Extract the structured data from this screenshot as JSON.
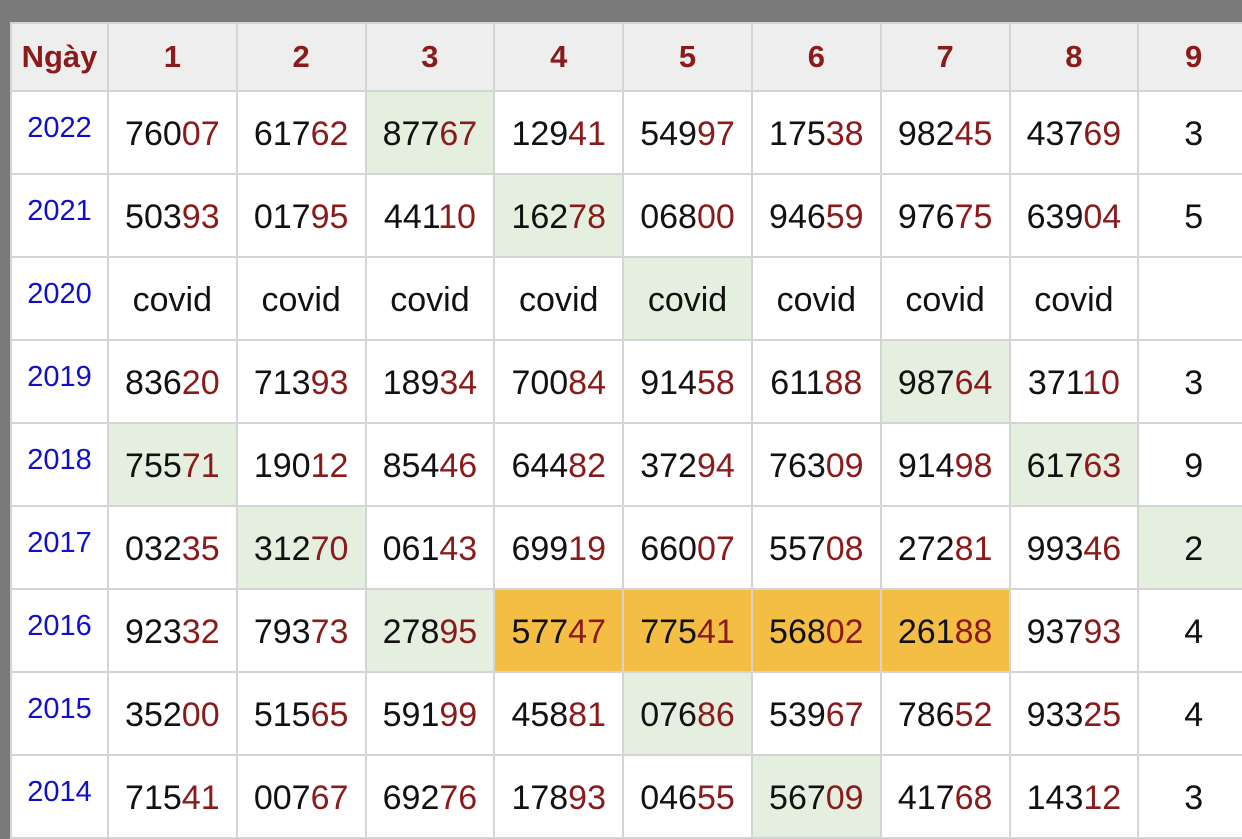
{
  "header": {
    "year_label": "Ngày",
    "days": [
      "1",
      "2",
      "3",
      "4",
      "5",
      "6",
      "7",
      "8",
      "9"
    ]
  },
  "colors": {
    "year_text": "#1010cc",
    "header_text": "#8b1a1a",
    "tail_digits": "#8b1a1a",
    "highlight_green": "#e5efdf",
    "highlight_gold": "#f3be43"
  },
  "rows": [
    {
      "year": "2022",
      "cells": [
        {
          "head": "760",
          "tail": "07"
        },
        {
          "head": "617",
          "tail": "62"
        },
        {
          "head": "877",
          "tail": "67",
          "hl": "green"
        },
        {
          "head": "129",
          "tail": "41"
        },
        {
          "head": "549",
          "tail": "97"
        },
        {
          "head": "175",
          "tail": "38"
        },
        {
          "head": "982",
          "tail": "45"
        },
        {
          "head": "437",
          "tail": "69"
        },
        {
          "head": "3",
          "tail": ""
        }
      ]
    },
    {
      "year": "2021",
      "cells": [
        {
          "head": "503",
          "tail": "93"
        },
        {
          "head": "017",
          "tail": "95"
        },
        {
          "head": "441",
          "tail": "10"
        },
        {
          "head": "162",
          "tail": "78",
          "hl": "green"
        },
        {
          "head": "068",
          "tail": "00"
        },
        {
          "head": "946",
          "tail": "59"
        },
        {
          "head": "976",
          "tail": "75"
        },
        {
          "head": "639",
          "tail": "04"
        },
        {
          "head": "5",
          "tail": ""
        }
      ]
    },
    {
      "year": "2020",
      "cells": [
        {
          "head": "covid",
          "tail": ""
        },
        {
          "head": "covid",
          "tail": ""
        },
        {
          "head": "covid",
          "tail": ""
        },
        {
          "head": "covid",
          "tail": ""
        },
        {
          "head": "covid",
          "tail": "",
          "hl": "green"
        },
        {
          "head": "covid",
          "tail": ""
        },
        {
          "head": "covid",
          "tail": ""
        },
        {
          "head": "covid",
          "tail": ""
        },
        {
          "head": "",
          "tail": ""
        }
      ]
    },
    {
      "year": "2019",
      "cells": [
        {
          "head": "836",
          "tail": "20"
        },
        {
          "head": "713",
          "tail": "93"
        },
        {
          "head": "189",
          "tail": "34"
        },
        {
          "head": "700",
          "tail": "84"
        },
        {
          "head": "914",
          "tail": "58"
        },
        {
          "head": "611",
          "tail": "88"
        },
        {
          "head": "987",
          "tail": "64",
          "hl": "green"
        },
        {
          "head": "371",
          "tail": "10"
        },
        {
          "head": "3",
          "tail": ""
        }
      ]
    },
    {
      "year": "2018",
      "cells": [
        {
          "head": "755",
          "tail": "71",
          "hl": "green"
        },
        {
          "head": "190",
          "tail": "12"
        },
        {
          "head": "854",
          "tail": "46"
        },
        {
          "head": "644",
          "tail": "82"
        },
        {
          "head": "372",
          "tail": "94"
        },
        {
          "head": "763",
          "tail": "09"
        },
        {
          "head": "914",
          "tail": "98"
        },
        {
          "head": "617",
          "tail": "63",
          "hl": "green"
        },
        {
          "head": "9",
          "tail": ""
        }
      ]
    },
    {
      "year": "2017",
      "cells": [
        {
          "head": "032",
          "tail": "35"
        },
        {
          "head": "312",
          "tail": "70",
          "hl": "green"
        },
        {
          "head": "061",
          "tail": "43"
        },
        {
          "head": "699",
          "tail": "19"
        },
        {
          "head": "660",
          "tail": "07"
        },
        {
          "head": "557",
          "tail": "08"
        },
        {
          "head": "272",
          "tail": "81"
        },
        {
          "head": "993",
          "tail": "46"
        },
        {
          "head": "2",
          "tail": "",
          "hl": "green"
        }
      ]
    },
    {
      "year": "2016",
      "cells": [
        {
          "head": "923",
          "tail": "32"
        },
        {
          "head": "793",
          "tail": "73"
        },
        {
          "head": "278",
          "tail": "95",
          "hl": "green"
        },
        {
          "head": "577",
          "tail": "47",
          "hl": "gold"
        },
        {
          "head": "775",
          "tail": "41",
          "hl": "gold"
        },
        {
          "head": "568",
          "tail": "02",
          "hl": "gold"
        },
        {
          "head": "261",
          "tail": "88",
          "hl": "gold"
        },
        {
          "head": "937",
          "tail": "93"
        },
        {
          "head": "4",
          "tail": ""
        }
      ]
    },
    {
      "year": "2015",
      "cells": [
        {
          "head": "352",
          "tail": "00"
        },
        {
          "head": "515",
          "tail": "65"
        },
        {
          "head": "591",
          "tail": "99"
        },
        {
          "head": "458",
          "tail": "81"
        },
        {
          "head": "076",
          "tail": "86",
          "hl": "green"
        },
        {
          "head": "539",
          "tail": "67"
        },
        {
          "head": "786",
          "tail": "52"
        },
        {
          "head": "933",
          "tail": "25"
        },
        {
          "head": "4",
          "tail": ""
        }
      ]
    },
    {
      "year": "2014",
      "cells": [
        {
          "head": "715",
          "tail": "41"
        },
        {
          "head": "007",
          "tail": "67"
        },
        {
          "head": "692",
          "tail": "76"
        },
        {
          "head": "178",
          "tail": "93"
        },
        {
          "head": "046",
          "tail": "55"
        },
        {
          "head": "567",
          "tail": "09",
          "hl": "green"
        },
        {
          "head": "417",
          "tail": "68"
        },
        {
          "head": "143",
          "tail": "12"
        },
        {
          "head": "3",
          "tail": ""
        }
      ]
    }
  ]
}
